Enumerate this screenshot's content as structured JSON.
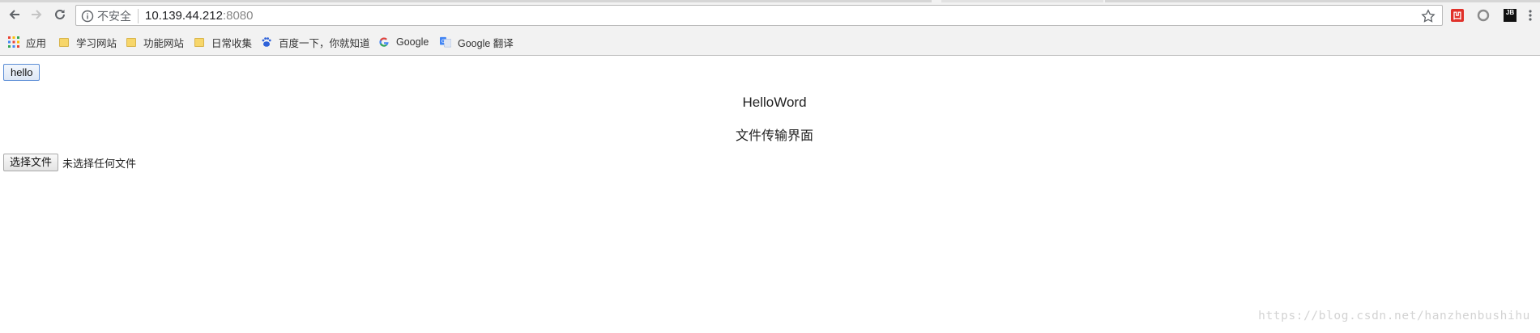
{
  "browser": {
    "security_label": "不安全",
    "url_host": "10.139.44.212",
    "url_port": ":8080",
    "icons": [
      "back-icon",
      "forward-icon",
      "reload-icon",
      "info-icon",
      "star-icon",
      "extension-icons",
      "menu-icon"
    ]
  },
  "bookmarks": {
    "items": [
      {
        "label": "应用",
        "icon": "apps-grid-icon"
      },
      {
        "label": "学习网站",
        "icon": "folder-icon"
      },
      {
        "label": "功能网站",
        "icon": "folder-icon"
      },
      {
        "label": "日常收集",
        "icon": "folder-icon"
      },
      {
        "label": "百度一下，你就知道",
        "icon": "baidu-paw-icon"
      },
      {
        "label": "Google",
        "icon": "google-g-icon"
      },
      {
        "label": "Google 翻译",
        "icon": "google-translate-icon"
      }
    ]
  },
  "page": {
    "hello_button": "hello",
    "heading": "HelloWord",
    "subheading": "文件传输界面",
    "file_button": "选择文件",
    "file_status": "未选择任何文件"
  },
  "watermark": "https://blog.csdn.net/hanzhenbushihu"
}
